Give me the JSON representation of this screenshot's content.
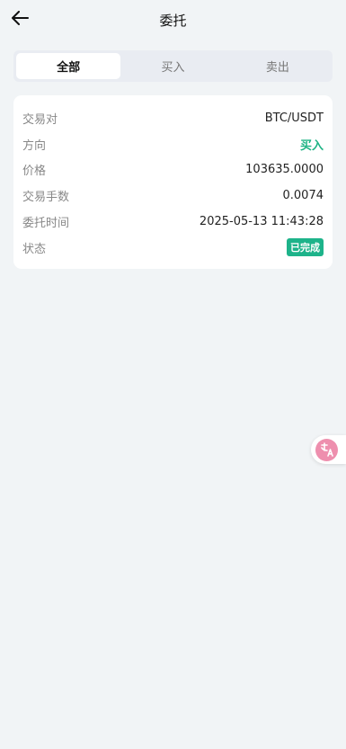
{
  "header": {
    "title": "委托"
  },
  "tabs": [
    {
      "label": "全部",
      "active": true
    },
    {
      "label": "买入",
      "active": false
    },
    {
      "label": "卖出",
      "active": false
    }
  ],
  "order": {
    "rows": [
      {
        "label": "交易对",
        "value": "BTC/USDT"
      },
      {
        "label": "方向",
        "value": "买入"
      },
      {
        "label": "价格",
        "value": "103635.0000"
      },
      {
        "label": "交易手数",
        "value": "0.0074"
      },
      {
        "label": "委托时间",
        "value": "2025-05-13 11:43:28"
      },
      {
        "label": "状态",
        "value": "已完成"
      }
    ]
  },
  "colors": {
    "accent_green": "#1db384",
    "translate_pink": "#ee8fae"
  },
  "icons": {
    "back": "arrow-left-icon",
    "translate": "translate-icon"
  }
}
